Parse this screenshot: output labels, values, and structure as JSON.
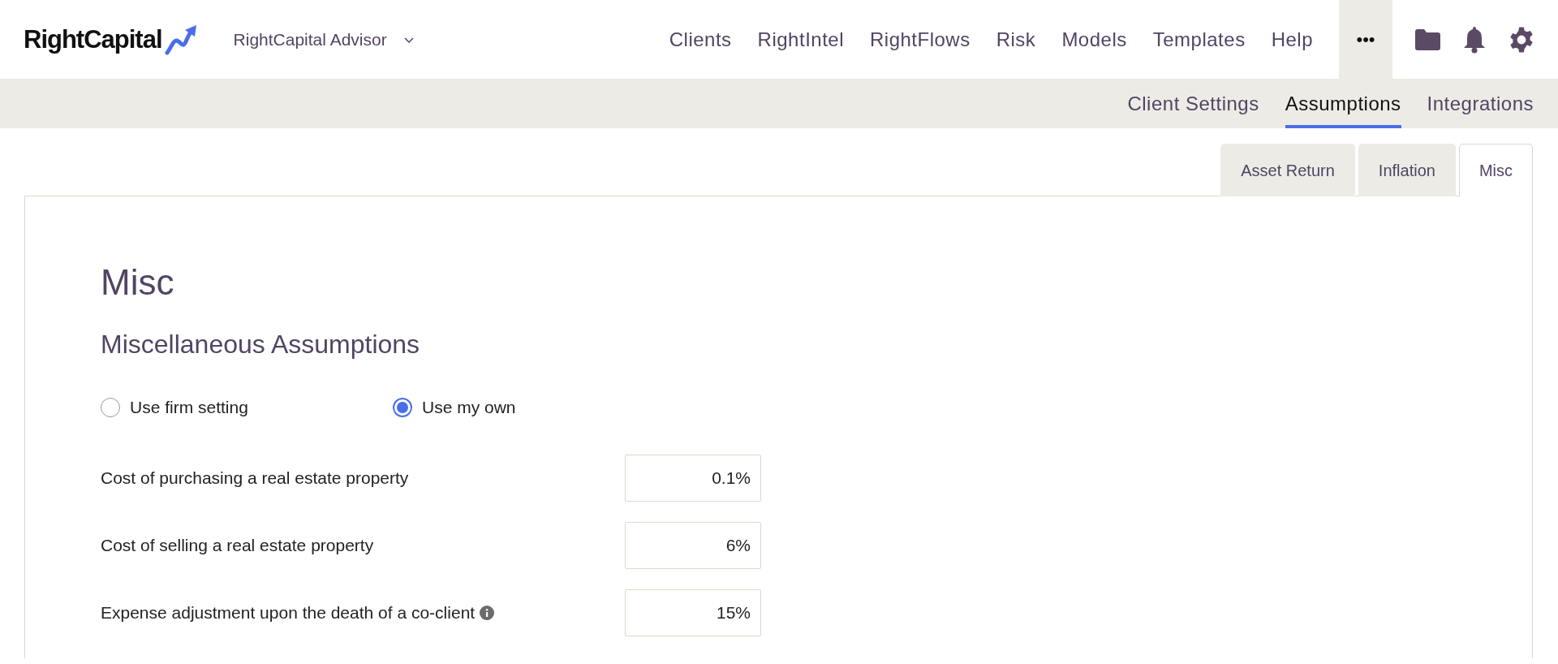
{
  "header": {
    "logo": "RightCapital",
    "account": "RightCapital Advisor",
    "nav": [
      {
        "label": "Clients"
      },
      {
        "label": "RightIntel"
      },
      {
        "label": "RightFlows"
      },
      {
        "label": "Risk"
      },
      {
        "label": "Models"
      },
      {
        "label": "Templates"
      },
      {
        "label": "Help"
      }
    ],
    "more": "•••"
  },
  "subnav": [
    {
      "label": "Client Settings",
      "selected": false
    },
    {
      "label": "Assumptions",
      "selected": true
    },
    {
      "label": "Integrations",
      "selected": false
    }
  ],
  "tabs": [
    {
      "label": "Asset Return",
      "selected": false
    },
    {
      "label": "Inflation",
      "selected": false
    },
    {
      "label": "Misc",
      "selected": true
    }
  ],
  "panel": {
    "title": "Misc",
    "subtitle": "Miscellaneous Assumptions",
    "radios": [
      {
        "label": "Use firm setting",
        "selected": false
      },
      {
        "label": "Use my own",
        "selected": true
      }
    ],
    "fields": [
      {
        "label": "Cost of purchasing a real estate property",
        "value": "0.1%",
        "info": false
      },
      {
        "label": "Cost of selling a real estate property",
        "value": "6%",
        "info": false
      },
      {
        "label": "Expense adjustment upon the death of a co-client",
        "value": "15%",
        "info": true
      }
    ]
  }
}
